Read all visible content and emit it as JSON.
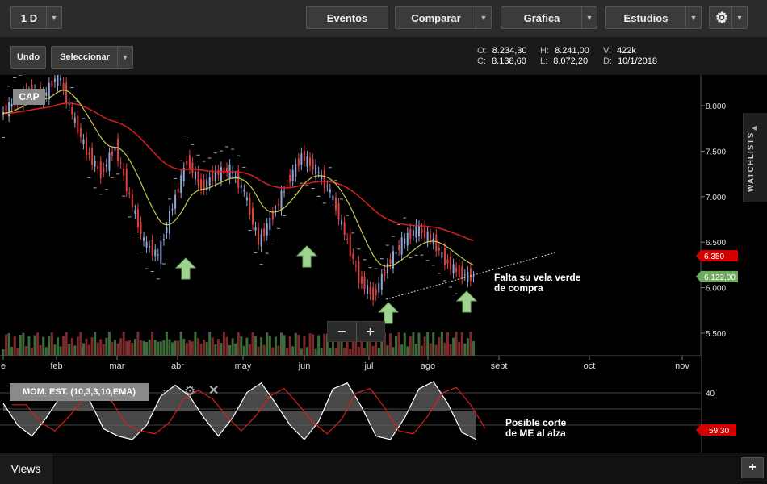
{
  "toolbar": {
    "interval": "1 D",
    "events": "Eventos",
    "compare": "Comparar",
    "chart": "Gráfica",
    "studies": "Estudios"
  },
  "subbar": {
    "undo": "Undo",
    "select": "Seleccionar"
  },
  "ohlc": {
    "o_label": "O:",
    "o": "8.234,30",
    "c_label": "C:",
    "c": "8.138,60",
    "h_label": "H:",
    "h": "8.241,00",
    "l_label": "L:",
    "l": "8.072,20",
    "v_label": "V:",
    "v": "422k",
    "d_label": "D:",
    "d": "10/1/2018"
  },
  "symbol": "CAP",
  "indicator": "MOM. EST. (10,3,3,10,EMA)",
  "watchlists": "WATCHLISTS",
  "views": "Views",
  "annotations": {
    "a1_line1": "Falta su vela verde",
    "a1_line2": "de compra",
    "a2_line1": "Posible corte",
    "a2_line2": "de ME al alza"
  },
  "colors": {
    "background": "#000000",
    "up_candle": "#8fa6d8",
    "down_candle": "#e04040",
    "signal_candle": "#9ad87c",
    "ema_fast": "#c8c84a",
    "ema_slow": "#d42020",
    "price_red": "#d40000",
    "price_green": "#6fa860",
    "arrow": "#9ed28f"
  },
  "chart_data": {
    "type": "candlestick",
    "x_ticks": [
      "e",
      "feb",
      "mar",
      "abr",
      "may",
      "jun",
      "jul",
      "ago",
      "sept",
      "oct",
      "nov"
    ],
    "y_ticks": [
      "8.000",
      "7.500",
      "7.000",
      "6.500",
      "6.000",
      "5.500"
    ],
    "ylim": [
      5300,
      8300
    ],
    "price_tags": [
      {
        "label": "6.350",
        "value": 6350,
        "color": "#d40000"
      },
      {
        "label": "6.122,00",
        "value": 6122,
        "color": "#6fa860"
      }
    ],
    "close_series": [
      7900,
      8050,
      8150,
      8100,
      8350,
      7900,
      7500,
      7250,
      7550,
      7000,
      6500,
      6350,
      6900,
      7400,
      7100,
      7250,
      7300,
      7050,
      6500,
      6800,
      7150,
      7450,
      7300,
      7050,
      6600,
      6100,
      5900,
      6250,
      6500,
      6650,
      6550,
      6300,
      6150,
      6120
    ],
    "indicator": {
      "ticks": [
        "40"
      ],
      "price_tag": "59,30",
      "series": [
        10,
        -20,
        -35,
        -10,
        20,
        30,
        15,
        -25,
        -35,
        -40,
        -20,
        20,
        35,
        20,
        -10,
        -35,
        -10,
        25,
        38,
        10,
        -20,
        -40,
        -15,
        30,
        38,
        5,
        -35,
        -40,
        -10,
        30,
        40,
        10,
        -30,
        -40
      ]
    }
  }
}
